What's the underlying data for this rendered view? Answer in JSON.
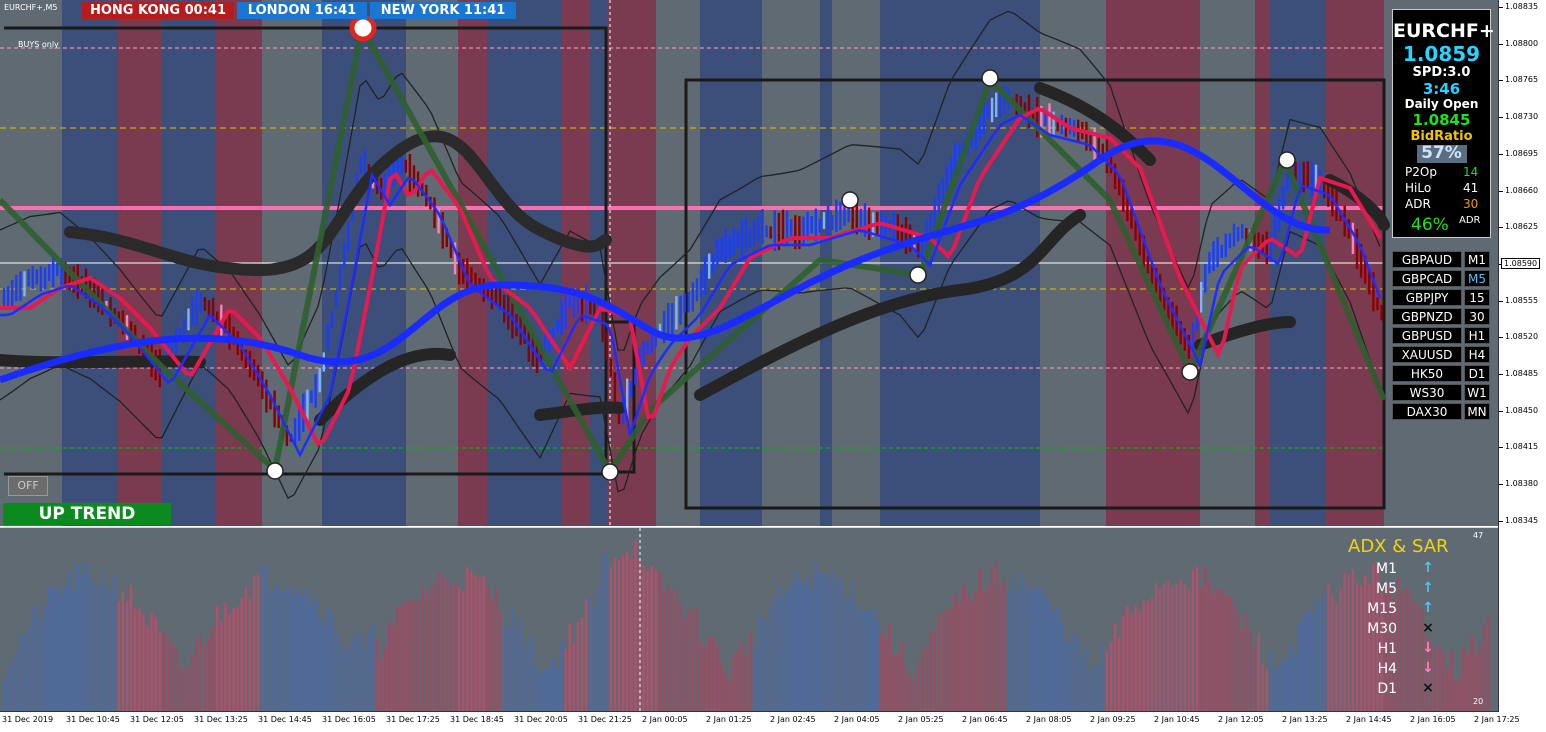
{
  "symbol": "EURCHF+,M5",
  "sessions": [
    {
      "name": "HONG KONG 00:41",
      "bg": "#b71c1c"
    },
    {
      "name": "LONDON   16:41",
      "bg": "#1976d2"
    },
    {
      "name": "NEW YORK  11:41",
      "bg": "#1976d2"
    }
  ],
  "buys_only": "BUYS only",
  "off_button": "OFF",
  "trend": "UP TREND",
  "info": {
    "pair": "EURCHF+",
    "price": "1.0859",
    "spread": "SPD:3.0",
    "timer": "3:46",
    "daily_open_label": "Daily Open",
    "daily_open": "1.0845",
    "bid_ratio_label": "BidRatio",
    "bid_ratio": "57%",
    "p2op_label": "P2Op",
    "p2op": "14",
    "hilo_label": "HiLo",
    "hilo": "41",
    "adr_label": "ADR",
    "adr": "30",
    "adr_pct": "46%",
    "adr_small": "ADR"
  },
  "pairs": [
    {
      "name": "GBPAUD",
      "tf": "M1",
      "tf_color": "#ffffff"
    },
    {
      "name": "GBPCAD",
      "tf": "M5",
      "tf_color": "#4fc3f7"
    },
    {
      "name": "GBPJPY",
      "tf": "15",
      "tf_color": "#ffffff"
    },
    {
      "name": "GBPNZD",
      "tf": "30",
      "tf_color": "#ffffff"
    },
    {
      "name": "GBPUSD",
      "tf": "H1",
      "tf_color": "#ffffff"
    },
    {
      "name": "XAUUSD",
      "tf": "H4",
      "tf_color": "#ffffff"
    },
    {
      "name": "HK50",
      "tf": "D1",
      "tf_color": "#ffffff"
    },
    {
      "name": "WS30",
      "tf": "W1",
      "tf_color": "#ffffff"
    },
    {
      "name": "DAX30",
      "tf": "MN",
      "tf_color": "#ffffff"
    }
  ],
  "adx": {
    "title": "ADX & SAR",
    "rows": [
      {
        "tf": "M1",
        "signal": "↑",
        "color": "#4fc3f7"
      },
      {
        "tf": "M5",
        "signal": "↑",
        "color": "#4fc3f7"
      },
      {
        "tf": "M15",
        "signal": "↑",
        "color": "#4fc3f7"
      },
      {
        "tf": "M30",
        "signal": "×",
        "color": "#111111"
      },
      {
        "tf": "H1",
        "signal": "↓",
        "color": "#ff80c0"
      },
      {
        "tf": "H4",
        "signal": "↓",
        "color": "#ff80c0"
      },
      {
        "tf": "D1",
        "signal": "×",
        "color": "#111111"
      }
    ]
  },
  "indicator_scale": {
    "top": "47",
    "bottom": "20"
  },
  "price_axis": [
    "1.08835",
    "1.08800",
    "1.08765",
    "1.08730",
    "1.08695",
    "1.08660",
    "1.08625",
    "1.08590",
    "1.08555",
    "1.08520",
    "1.08485",
    "1.08450",
    "1.08415",
    "1.08380",
    "1.08345"
  ],
  "current_price_label": "1.08590",
  "time_axis": [
    "31 Dec 2019",
    "31 Dec 10:45",
    "31 Dec 12:05",
    "31 Dec 13:25",
    "31 Dec 14:45",
    "31 Dec 16:05",
    "31 Dec 17:25",
    "31 Dec 18:45",
    "31 Dec 20:05",
    "31 Dec 21:25",
    "2 Jan 00:05",
    "2 Jan 01:25",
    "2 Jan 02:45",
    "2 Jan 04:05",
    "2 Jan 05:25",
    "2 Jan 06:45",
    "2 Jan 08:05",
    "2 Jan 09:25",
    "2 Jan 10:45",
    "2 Jan 12:05",
    "2 Jan 13:25",
    "2 Jan 14:45",
    "2 Jan 16:05",
    "2 Jan 17:25"
  ],
  "colors": {
    "bull_band": "#3b4f7a",
    "bear_band": "#7a3b50",
    "neutral": "#5f6a73",
    "bull_bar": "#1a3cff",
    "bear_bar": "#8b0000",
    "ma_red": "#e8194f",
    "ma_blue": "#1f2bff"
  }
}
